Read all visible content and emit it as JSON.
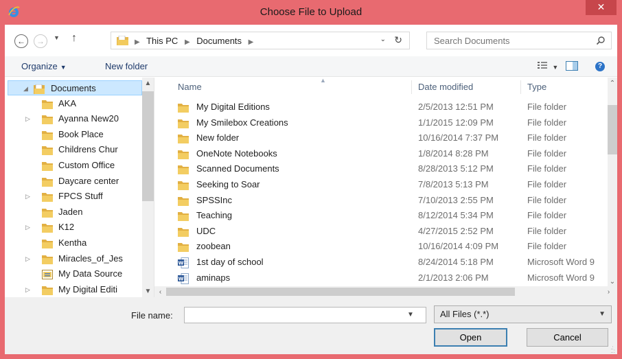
{
  "window": {
    "title": "Choose File to Upload",
    "close_label": "✕",
    "frame_color": "#e86a70",
    "icon": "internet-explorer-icon"
  },
  "navigation": {
    "back_icon": "back-arrow-icon",
    "forward_icon": "forward-arrow-icon",
    "recent_icon": "chevron-down-icon",
    "up_icon": "up-arrow-icon",
    "breadcrumbs": [
      "This PC",
      "Documents"
    ],
    "refresh_icon": "refresh-icon"
  },
  "search": {
    "placeholder": "Search Documents",
    "icon": "search-icon"
  },
  "toolbar": {
    "organize_label": "Organize",
    "new_folder_label": "New folder",
    "views_icon": "view-options-icon",
    "preview_icon": "preview-pane-icon",
    "help_icon": "help-icon"
  },
  "nav_tree": {
    "items": [
      {
        "label": "Documents",
        "expander": "◢",
        "icon": "documents-folder-icon",
        "selected": true
      },
      {
        "label": "AKA",
        "expander": "",
        "icon": "folder-icon"
      },
      {
        "label": "Ayanna New20",
        "expander": "▷",
        "icon": "folder-icon"
      },
      {
        "label": "Book Place",
        "expander": "",
        "icon": "folder-icon"
      },
      {
        "label": "Childrens Chur",
        "expander": "",
        "icon": "folder-icon"
      },
      {
        "label": "Custom Office",
        "expander": "",
        "icon": "folder-icon"
      },
      {
        "label": "Daycare center",
        "expander": "",
        "icon": "folder-icon"
      },
      {
        "label": "FPCS Stuff",
        "expander": "▷",
        "icon": "folder-icon"
      },
      {
        "label": "Jaden",
        "expander": "",
        "icon": "folder-icon"
      },
      {
        "label": "K12",
        "expander": "▷",
        "icon": "folder-icon"
      },
      {
        "label": "Kentha",
        "expander": "",
        "icon": "folder-icon"
      },
      {
        "label": "Miracles_of_Jes",
        "expander": "▷",
        "icon": "folder-icon"
      },
      {
        "label": "My Data Source",
        "expander": "",
        "icon": "data-source-icon"
      },
      {
        "label": "My Digital Editi",
        "expander": "▷",
        "icon": "folder-icon"
      }
    ]
  },
  "file_list": {
    "columns": [
      "Name",
      "Date modified",
      "Type"
    ],
    "rows": [
      {
        "name": "My Digital Editions",
        "date": "2/5/2013 12:51 PM",
        "type": "File folder",
        "icon": "folder-icon"
      },
      {
        "name": "My Smilebox Creations",
        "date": "1/1/2015 12:09 PM",
        "type": "File folder",
        "icon": "folder-icon"
      },
      {
        "name": "New folder",
        "date": "10/16/2014 7:37 PM",
        "type": "File folder",
        "icon": "folder-icon"
      },
      {
        "name": "OneNote Notebooks",
        "date": "1/8/2014 8:28 PM",
        "type": "File folder",
        "icon": "folder-icon"
      },
      {
        "name": "Scanned Documents",
        "date": "8/28/2013 5:12 PM",
        "type": "File folder",
        "icon": "folder-icon"
      },
      {
        "name": "Seeking to Soar",
        "date": "7/8/2013 5:13 PM",
        "type": "File folder",
        "icon": "folder-icon"
      },
      {
        "name": "SPSSInc",
        "date": "7/10/2013 2:55 PM",
        "type": "File folder",
        "icon": "folder-icon"
      },
      {
        "name": "Teaching",
        "date": "8/12/2014 5:34 PM",
        "type": "File folder",
        "icon": "folder-icon"
      },
      {
        "name": "UDC",
        "date": "4/27/2015 2:52 PM",
        "type": "File folder",
        "icon": "folder-icon"
      },
      {
        "name": "zoobean",
        "date": "10/16/2014 4:09 PM",
        "type": "File folder",
        "icon": "folder-icon"
      },
      {
        "name": "1st day of school",
        "date": "8/24/2014 5:18 PM",
        "type": "Microsoft Word 9",
        "icon": "word-document-icon"
      },
      {
        "name": "aminaps",
        "date": "2/1/2013 2:06 PM",
        "type": "Microsoft Word 9",
        "icon": "word-document-icon"
      }
    ]
  },
  "footer": {
    "file_name_label": "File name:",
    "file_name_value": "",
    "filter_value": "All Files (*.*)",
    "open_label": "Open",
    "cancel_label": "Cancel"
  }
}
